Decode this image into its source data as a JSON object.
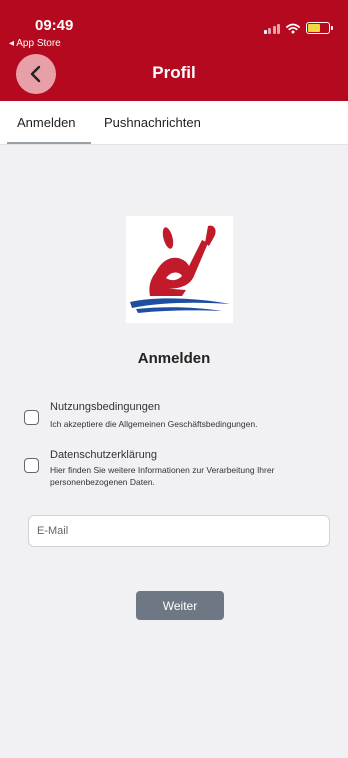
{
  "status_bar": {
    "time": "09:49",
    "back_app": "◂ App Store"
  },
  "header": {
    "title": "Profil"
  },
  "tabs": [
    {
      "label": "Anmelden"
    },
    {
      "label": "Pushnachrichten"
    }
  ],
  "login": {
    "heading": "Anmelden",
    "terms": {
      "title": "Nutzungsbedingungen",
      "description": "Ich akzeptiere die Allgemeinen Geschäftsbedingungen."
    },
    "privacy": {
      "title": "Datenschutzerklärung",
      "description": "Hier finden Sie weitere Informationen zur Verarbeitung Ihrer personenbezogenen Daten."
    },
    "email_placeholder": "E-Mail",
    "submit_label": "Weiter"
  },
  "colors": {
    "brand": "#b5091f",
    "button": "#6e7884",
    "background": "#f1f1f4"
  }
}
